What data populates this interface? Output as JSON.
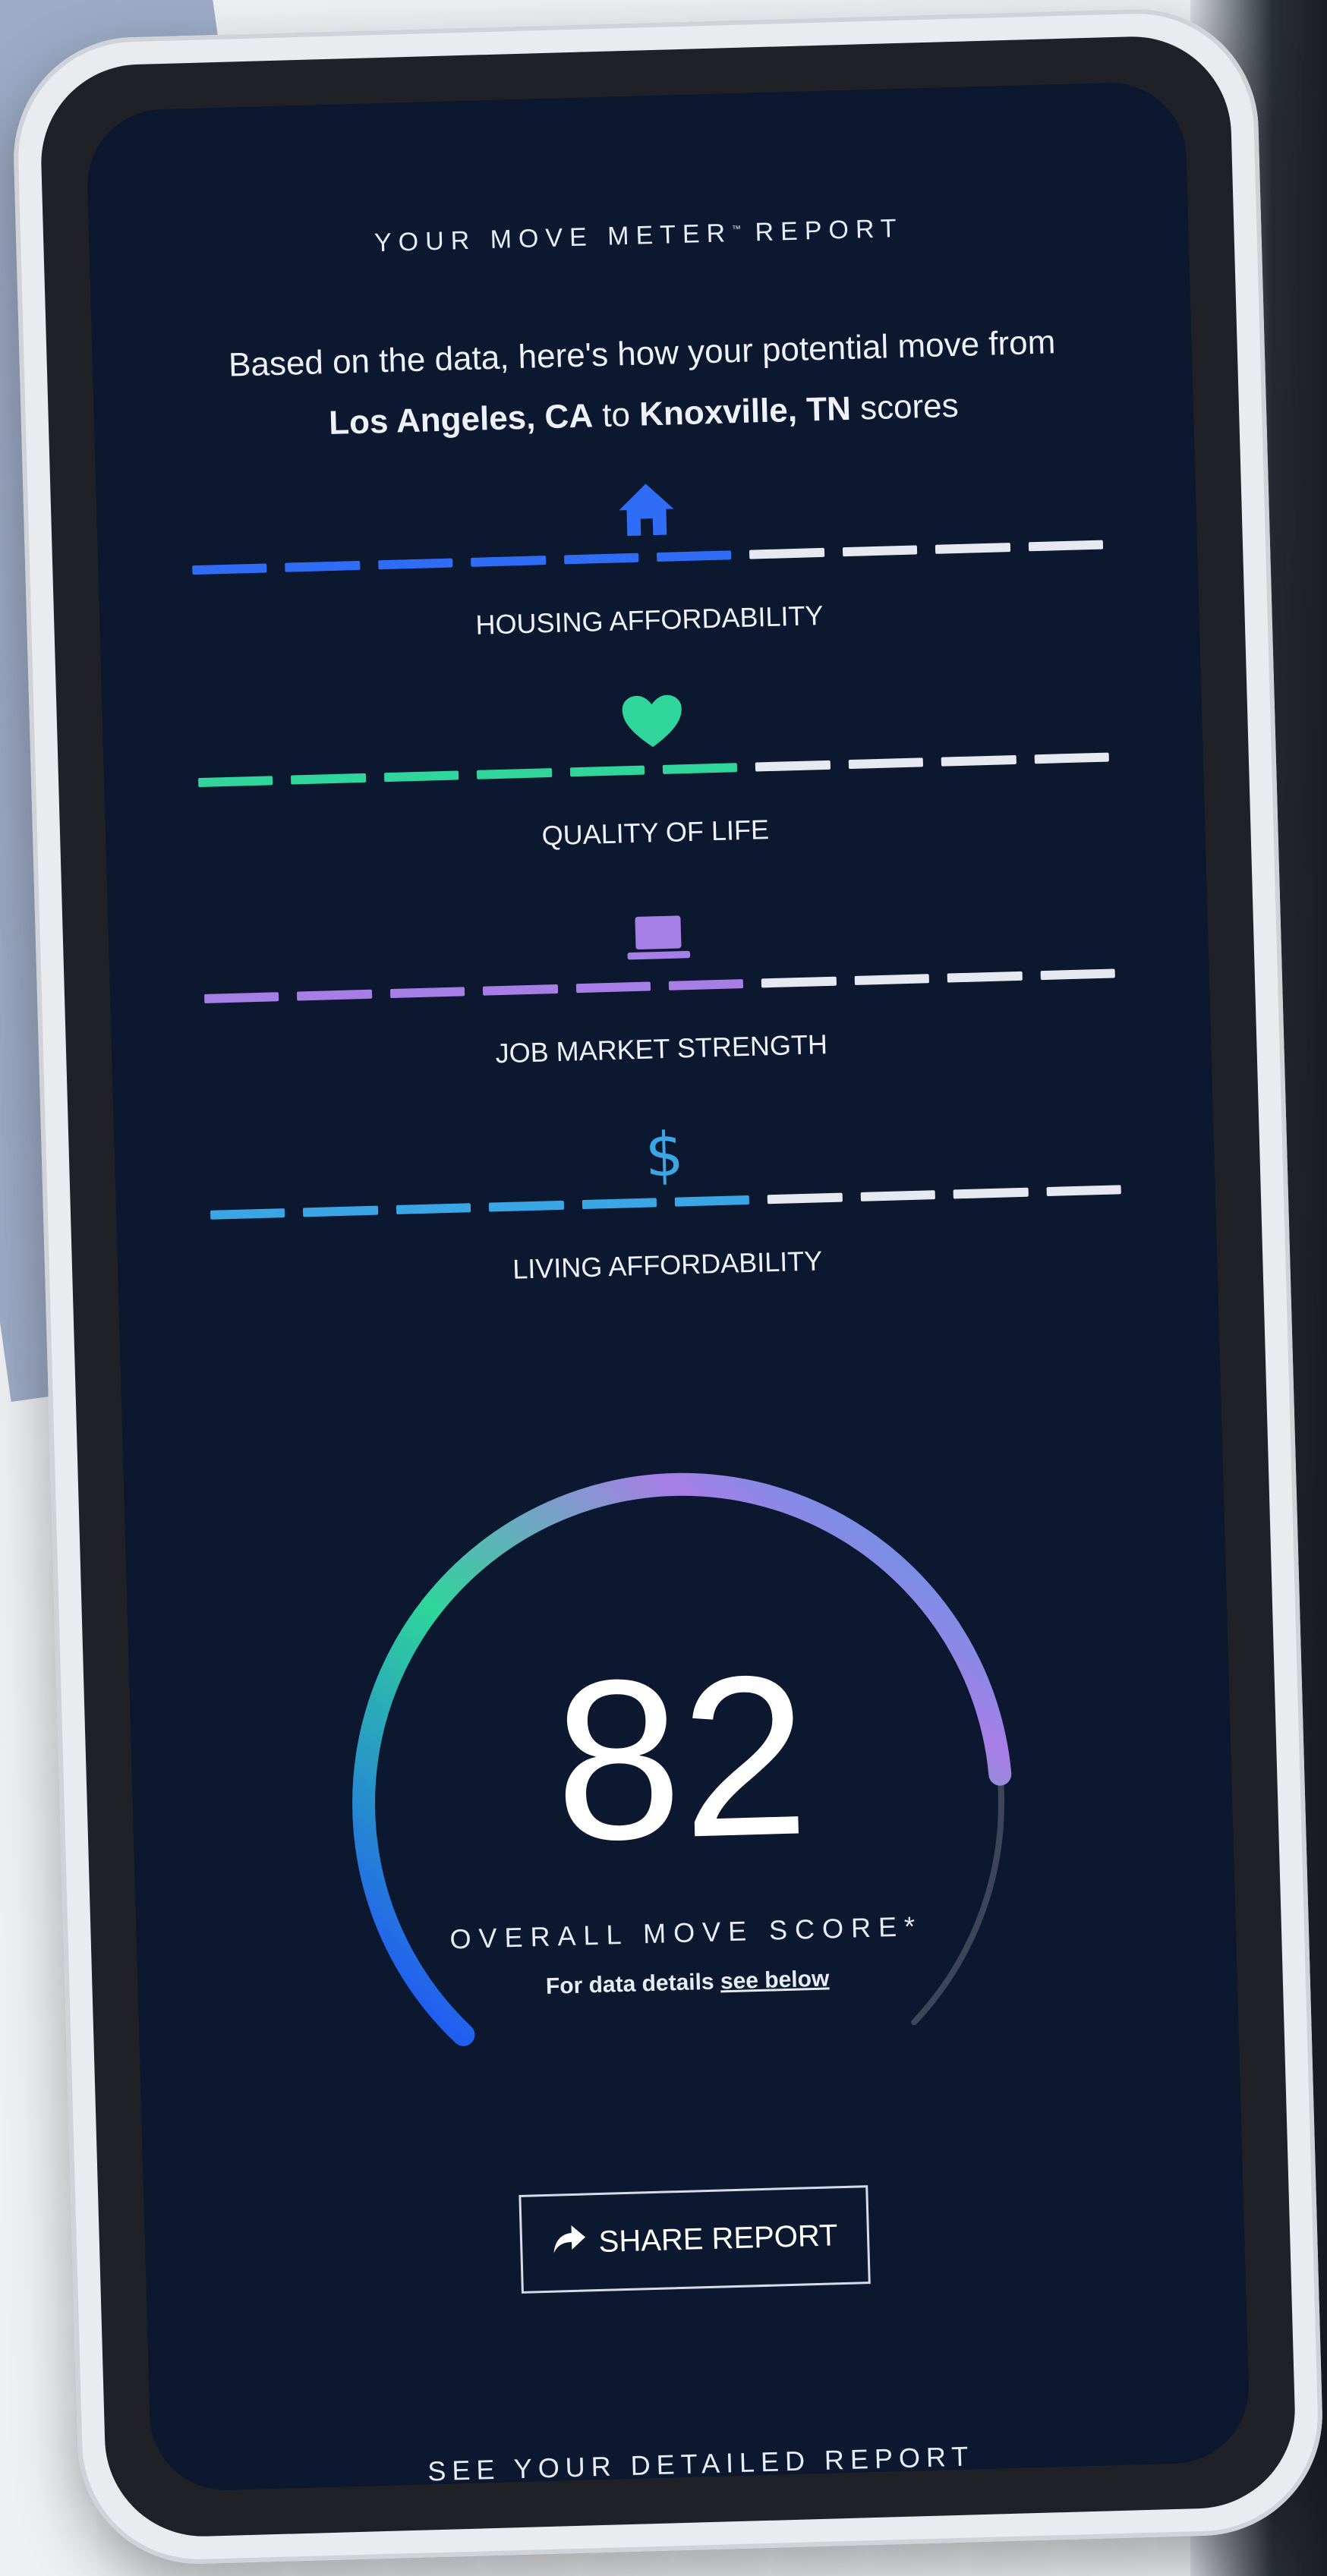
{
  "report": {
    "title_main": "YOUR MOVE METER",
    "title_tm": "™",
    "title_suffix": "REPORT",
    "intro_line1": "Based on the data, here's how your potential move from",
    "from_city": "Los Angeles, CA",
    "to_word": "to",
    "to_city": "Knoxville, TN",
    "scores_word": "scores"
  },
  "metrics": [
    {
      "label": "HOUSING AFFORDABILITY",
      "icon": "house-icon",
      "color": "#2f6df6",
      "filled": 6,
      "total": 10
    },
    {
      "label": "QUALITY OF LIFE",
      "icon": "heart-icon",
      "color": "#2fd59a",
      "filled": 6,
      "total": 10
    },
    {
      "label": "JOB MARKET STRENGTH",
      "icon": "laptop-icon",
      "color": "#a77ee6",
      "filled": 6,
      "total": 10
    },
    {
      "label": "LIVING AFFORDABILITY",
      "icon": "dollar-icon",
      "color": "#3aa6e6",
      "filled": 6,
      "total": 10
    }
  ],
  "gauge": {
    "score": "82",
    "score_value": 82,
    "label": "OVERALL MOVE SCORE*",
    "details_prefix": "For data details",
    "details_link": "see below"
  },
  "share": {
    "label": "SHARE REPORT",
    "icon": "share-arrow-icon"
  },
  "footer": {
    "label": "SEE YOUR DETAILED REPORT",
    "icon": "chevron-down-icon"
  },
  "colors": {
    "screen_bg": "#0c1730",
    "empty_segment": "#e6e9ef",
    "gauge_track": "#3d4659"
  }
}
